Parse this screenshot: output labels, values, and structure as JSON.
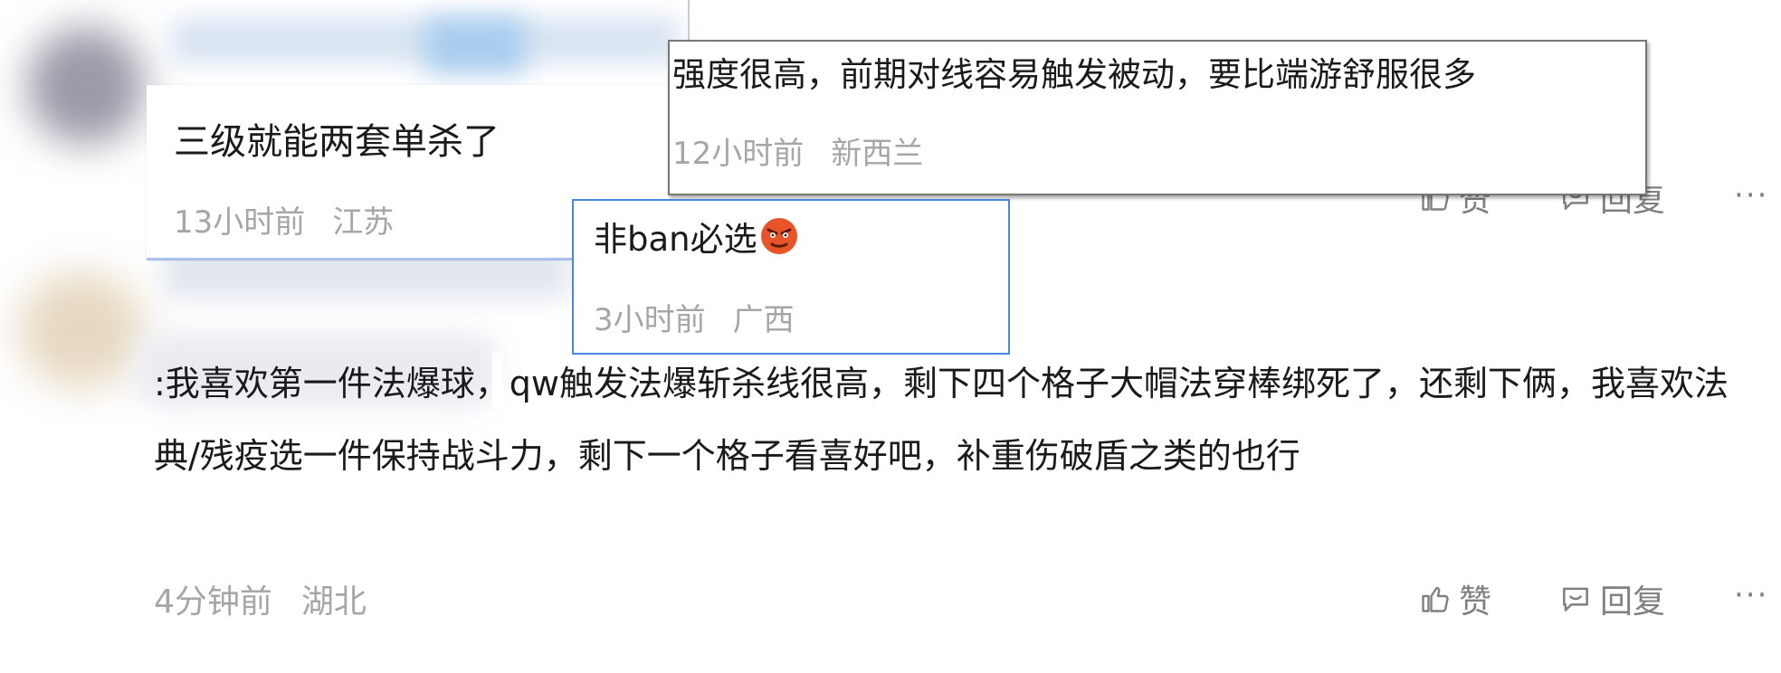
{
  "popup_level3": {
    "text": "三级就能两套单杀了",
    "time": "13小时前",
    "region": "江苏"
  },
  "popup_level12": {
    "text": "强度很高，前期对线容易触发被动，要比端游舒服很多",
    "time": "12小时前",
    "region": "新西兰"
  },
  "popup_ban": {
    "text": "非ban必选",
    "time": "3小时前",
    "region": "广西"
  },
  "main_comment": {
    "text": ":我喜欢第一件法爆球，qw触发法爆斩杀线很高，剩下四个格子大帽法穿棒绑死了，还剩下俩，我喜欢法典/残疫选一件保持战斗力，剩下一个格子看喜好吧，补重伤破盾之类的也行",
    "time": "4分钟前",
    "region": "湖北",
    "like_label": "赞",
    "reply_label": "回复"
  },
  "partial_actions": {
    "like_label": "赞",
    "reply_label": "回复"
  }
}
